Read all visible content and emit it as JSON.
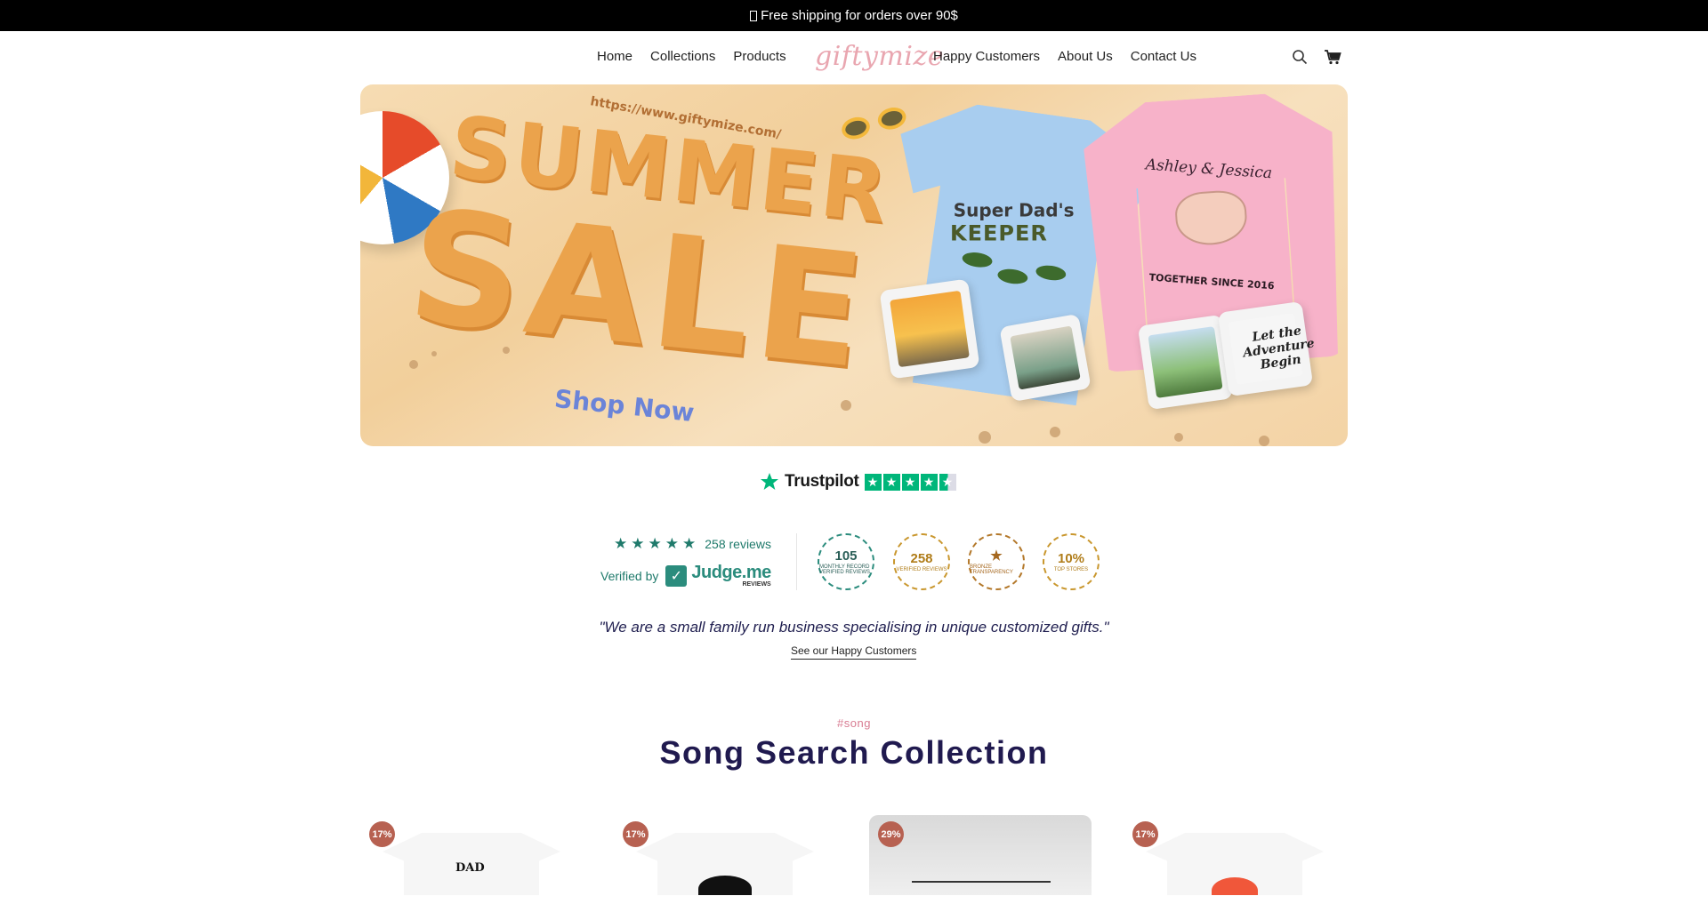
{
  "announcement": {
    "text": "Free shipping for orders over 90$"
  },
  "header": {
    "nav_left": [
      "Home",
      "Collections",
      "Products"
    ],
    "logo": "giftymize",
    "nav_right": [
      "Happy Customers",
      "About Us",
      "Contact Us"
    ],
    "icons": [
      "search-icon",
      "cart-icon"
    ]
  },
  "banner": {
    "url": "https://www.giftymize.com/",
    "headline_1": "SUMMER",
    "headline_2": "SALE",
    "cta": "Shop Now",
    "tee_text_1": "Super Dad's",
    "tee_text_2": "KEEPER",
    "sweatshirt_names": "Ashley & Jessica",
    "sweatshirt_since": "TOGETHER SINCE 2016",
    "mug_text": "Let the Adventure Begin"
  },
  "trustpilot": {
    "label": "Trustpilot",
    "stars": 4.5
  },
  "judgeme": {
    "rating_stars": 5,
    "reviews_text": "258 reviews",
    "verified_by": "Verified by",
    "brand": "Judge.me",
    "brand_sub": "REVIEWS",
    "badges": [
      {
        "number": "105",
        "caption": "Monthly record verified reviews"
      },
      {
        "number": "258",
        "caption": "Verified reviews"
      },
      {
        "number": "★",
        "caption": "Bronze transparency"
      },
      {
        "number": "10%",
        "caption": "Top stores"
      }
    ]
  },
  "quote": "\"We are a small family run business specialising in unique customized gifts.\"",
  "see_link": "See our Happy Customers",
  "collection": {
    "tag": "#song",
    "title": "Song Search Collection",
    "products": [
      {
        "discount": "17%",
        "style": "white-tee",
        "print": "DAD"
      },
      {
        "discount": "17%",
        "style": "white-tee",
        "print": ""
      },
      {
        "discount": "29%",
        "style": "grey-canvas",
        "print": ""
      },
      {
        "discount": "17%",
        "style": "white-tee",
        "print": ""
      }
    ]
  },
  "colors": {
    "accent_navy": "#201a4f",
    "badge_discount": "#b76151",
    "judge_green": "#1f7a6b",
    "trustpilot_green": "#00b67a"
  }
}
